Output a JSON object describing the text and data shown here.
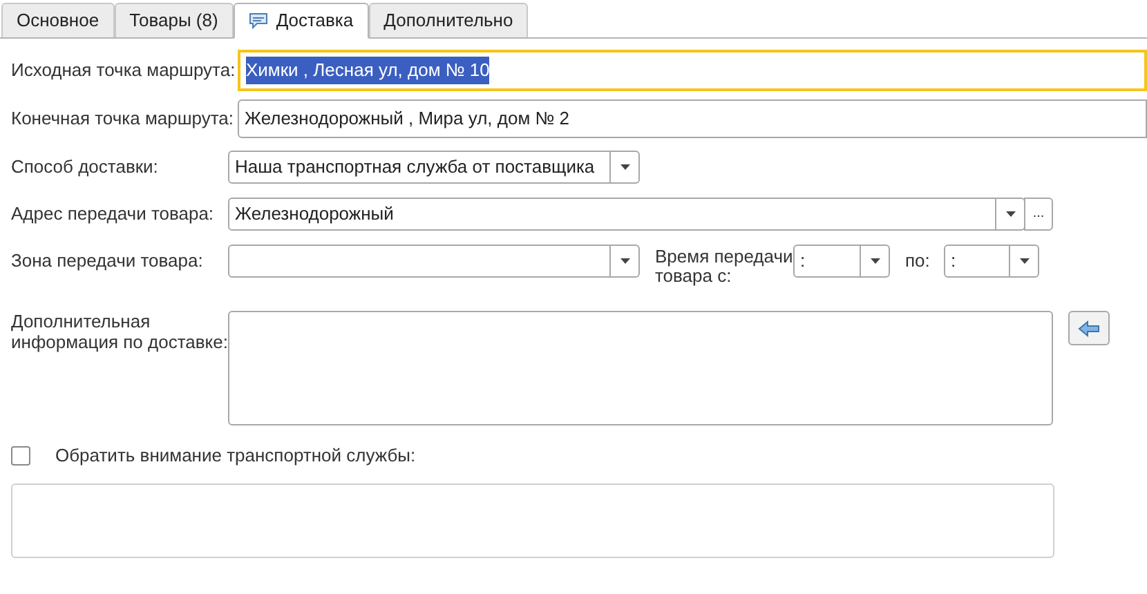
{
  "tabs": [
    {
      "label": "Основное",
      "selected": false,
      "icon": false
    },
    {
      "label": "Товары (8)",
      "selected": false,
      "icon": false
    },
    {
      "label": "Доставка",
      "selected": true,
      "icon": true
    },
    {
      "label": "Дополнительно",
      "selected": false,
      "icon": false
    }
  ],
  "route": [
    {
      "label": "Исходная точка маршрута:",
      "value": "Химки , Лесная ул, дом № 10",
      "focused": true
    },
    {
      "label": "Конечная точка маршрута:",
      "value": "Железнодорожный , Мира ул, дом № 2",
      "focused": false
    }
  ],
  "delivery_method": {
    "label": "Способ доставки:",
    "value": "Наша транспортная служба от поставщика"
  },
  "handover_address": {
    "label": "Адрес передачи товара:",
    "value": "Железнодорожный",
    "more_button": "..."
  },
  "handover_zone": {
    "label": "Зона передачи товара:"
  },
  "time": {
    "label": "Время передачи товара с:",
    "from": ":",
    "to_label": "по:",
    "to": ":"
  },
  "additional_info": {
    "label": "Дополнительная информация по доставке:"
  },
  "attention": {
    "label": "Обратить внимание транспортной службы:",
    "checked": false
  }
}
